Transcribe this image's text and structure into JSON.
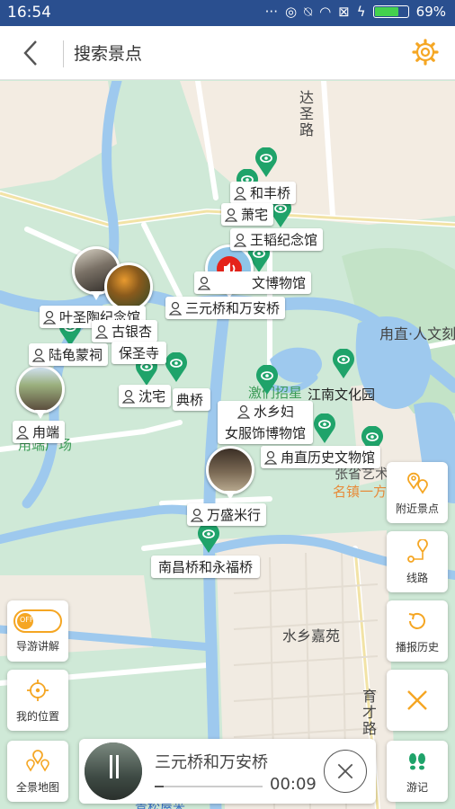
{
  "status_bar": {
    "time": "16:54",
    "battery": "69%"
  },
  "header": {
    "title": "搜索景点"
  },
  "map_labels": {
    "dasheng_road": "达圣路",
    "luzhi_renwen": "甪直·人文刻",
    "jiangnan_park": "江南文化园",
    "jiao_zhao": "激们招星",
    "zhang_yi": "张省艺术",
    "ming_zhen": "名镇一方",
    "shuixiang_jiayuan": "水乡嘉苑",
    "yucai_road": "育才路",
    "luduan_square": "甪端广场",
    "bottom_partial": "青松屋米"
  },
  "pois": {
    "hefeng_bridge": "和丰桥",
    "xiao_zhai": "萧宅",
    "wangtao": "王韬纪念馆",
    "wenbo_partial": "文博物馆",
    "sanyuan_bridge": "三元桥和万安桥",
    "yesheng_tao": "叶圣陶纪念馆",
    "gu_yinxing": "古银杏",
    "baosheng_temple": "保圣寺",
    "lugui_meng": "陆龟蒙祠",
    "shen_zhai": "沈宅",
    "dian_bridge_partial": "典桥",
    "luduan": "甪端",
    "shuixiang_line1": "水乡妇",
    "shuixiang_line2": "女服饰博物馆",
    "luzhi_history": "甪直历史文物馆",
    "wansheng_rice": "万盛米行",
    "nanchang_bridge": "南昌桥和永福桥"
  },
  "side_buttons": {
    "nearby": "附近景点",
    "route": "线路",
    "history": "播报历史",
    "guide": "导游讲解",
    "location": "我的位置",
    "fullmap": "全景地图",
    "travel": "游记"
  },
  "toggle_state": "OFF",
  "player": {
    "title": "三元桥和万安桥",
    "time": "00:09",
    "progress": 0.08
  },
  "colors": {
    "accent": "#f5a623",
    "pin_green": "#1fa36a",
    "water": "#9ec9ee",
    "status_bar": "#2a4f8f"
  }
}
